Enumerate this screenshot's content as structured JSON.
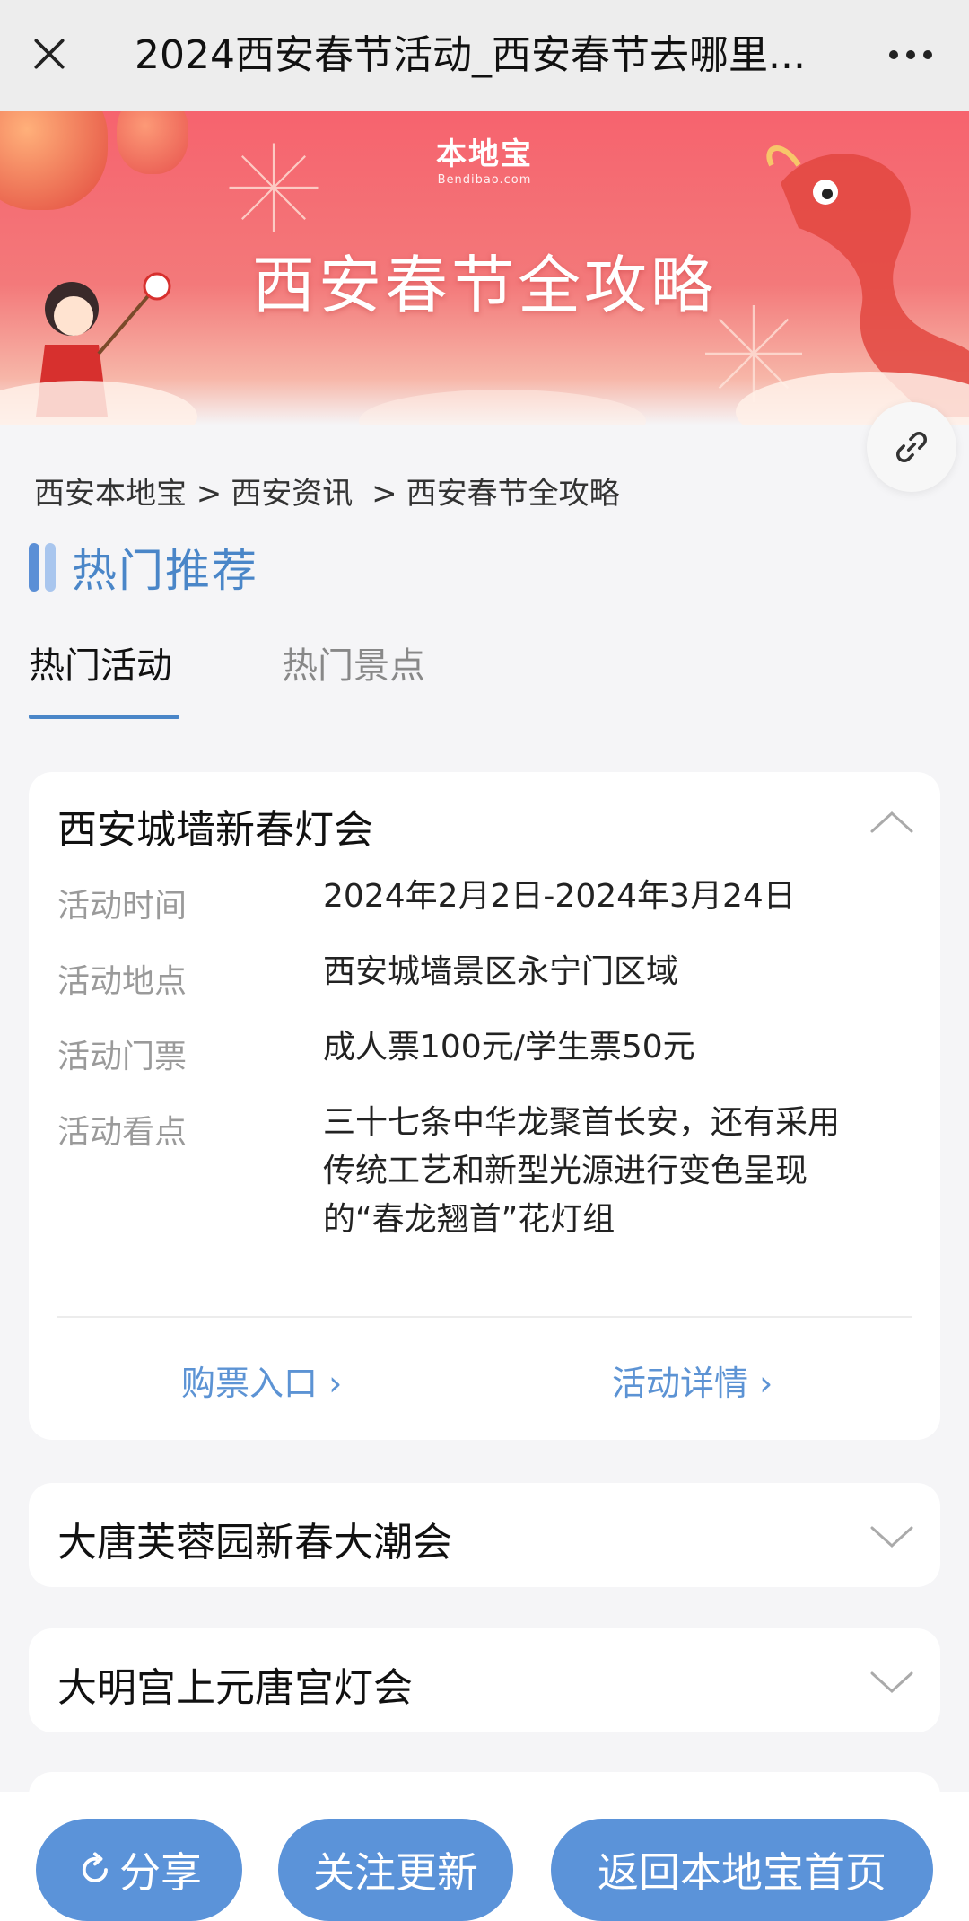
{
  "header": {
    "title": "2024西安春节活动_西安春节去哪里...",
    "close_icon": "close-icon",
    "more_icon": "more-dots-icon"
  },
  "banner": {
    "logo": "本地宝",
    "logo_sub": "Bendibao.com",
    "title": "西安春节全攻略",
    "accent_color": "#f6636e"
  },
  "breadcrumb": [
    "西安本地宝 >",
    "西安资讯 ",
    ">",
    "西安春节全攻略"
  ],
  "section": {
    "title": "热门推荐"
  },
  "tabs": [
    {
      "label": "热门活动",
      "active": true
    },
    {
      "label": "热门景点",
      "active": false
    }
  ],
  "cards": [
    {
      "title": "西安城墙新春灯会",
      "expanded": true,
      "rows": [
        {
          "label": "活动时间",
          "value": "2024年2月2日-2024年3月24日"
        },
        {
          "label": "活动地点",
          "value": "西安城墙景区永宁门区域"
        },
        {
          "label": "活动门票",
          "value": "成人票100元/学生票50元"
        },
        {
          "label": "活动看点",
          "value": "三十七条中华龙聚首长安，还有采用传统工艺和新型光源进行变色呈现的“春龙翘首”花灯组"
        }
      ],
      "actions": [
        "购票入口 ›",
        "活动详情 ›"
      ]
    },
    {
      "title": "大唐芙蓉园新春大潮会",
      "expanded": false
    },
    {
      "title": "大明宫上元唐宫灯会",
      "expanded": false
    }
  ],
  "bottom_bar": {
    "share": "分享",
    "follow": "关注更新",
    "home": "返回本地宝首页",
    "button_color": "#5b93d9"
  }
}
